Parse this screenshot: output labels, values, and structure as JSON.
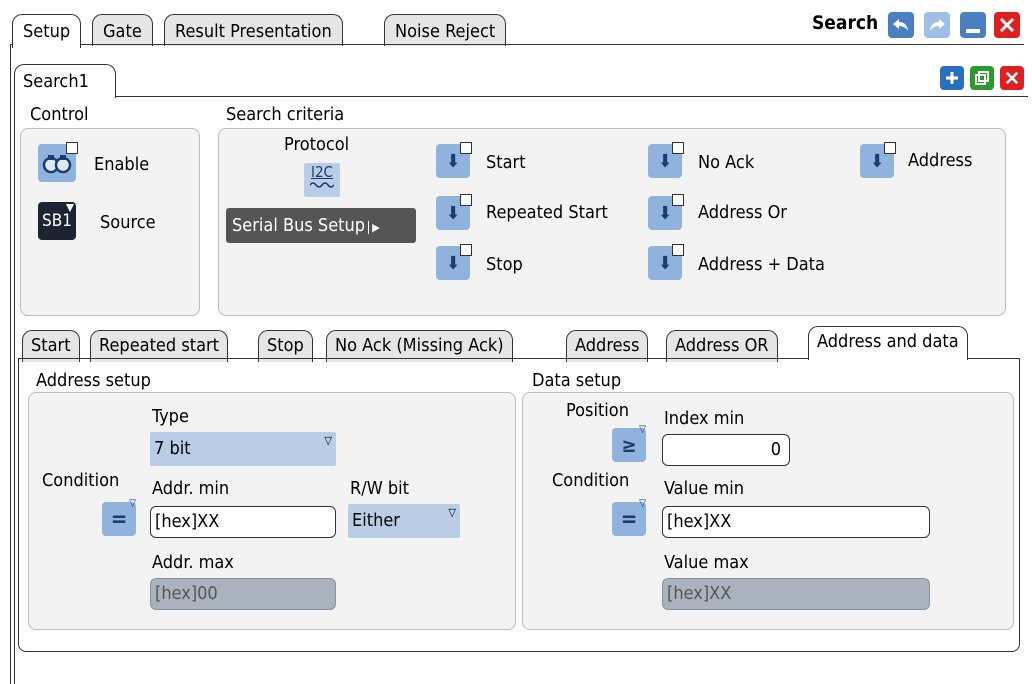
{
  "window": {
    "title": "Search",
    "tabs": [
      "Setup",
      "Gate",
      "Result Presentation",
      "Noise Reject"
    ],
    "subtab": "Search1"
  },
  "control": {
    "title": "Control",
    "enable_label": "Enable",
    "source_label": "Source",
    "source_value": "SB1"
  },
  "criteria": {
    "title": "Search criteria",
    "protocol_label": "Protocol",
    "protocol_icon_text": "I2C",
    "serial_bus_setup": "Serial Bus Setup",
    "items": [
      "Start",
      "Repeated Start",
      "Stop",
      "No Ack",
      "Address Or",
      "Address + Data",
      "Address"
    ]
  },
  "bottom_tabs": [
    "Start",
    "Repeated start",
    "Stop",
    "No Ack (Missing Ack)",
    "Address",
    "Address OR",
    "Address and data"
  ],
  "address_setup": {
    "title": "Address setup",
    "type_label": "Type",
    "type_value": "7 bit",
    "condition_label": "Condition",
    "condition_value": "=",
    "addr_min_label": "Addr. min",
    "addr_min_value": "[hex]XX",
    "rw_label": "R/W bit",
    "rw_value": "Either",
    "addr_max_label": "Addr. max",
    "addr_max_value": "[hex]00"
  },
  "data_setup": {
    "title": "Data setup",
    "position_label": "Position",
    "position_value": "≥",
    "index_min_label": "Index min",
    "index_min_value": "0",
    "condition_label": "Condition",
    "condition_value": "=",
    "value_min_label": "Value min",
    "value_min_value": "[hex]XX",
    "value_max_label": "Value max",
    "value_max_value": "[hex]XX"
  },
  "colors": {
    "accent": "#8fb3dc",
    "close": "#e02020",
    "add": "#2b6fc0",
    "copy": "#2a9a2a"
  }
}
